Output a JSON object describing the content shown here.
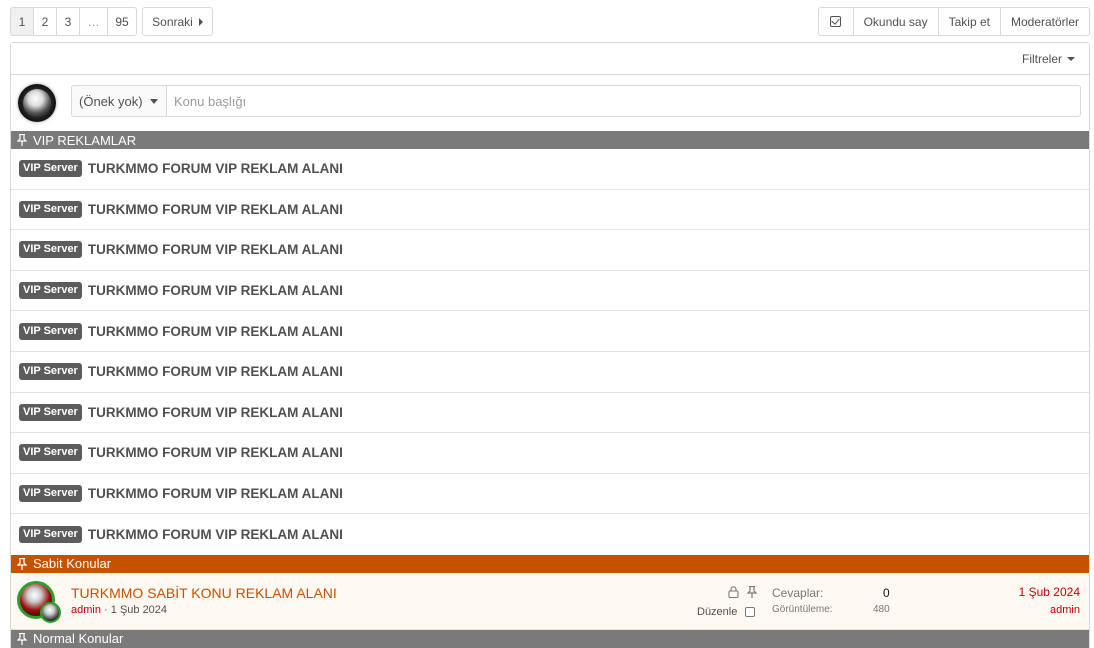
{
  "pagination": {
    "pages": [
      "1",
      "2",
      "3",
      "…",
      "95"
    ],
    "next_label": "Sonraki"
  },
  "actions": {
    "mark_read": "Okundu say",
    "follow": "Takip et",
    "moderators": "Moderatörler"
  },
  "filters_label": "Filtreler",
  "quick_thread": {
    "prefix_value": "(Önek yok)",
    "title_placeholder": "Konu başlığı"
  },
  "sections": {
    "vip": "VIP REKLAMLAR",
    "sticky": "Sabit Konular",
    "normal": "Normal Konular"
  },
  "vip_threads": [
    {
      "prefix": "VIP Server",
      "title": "TURKMMO FORUM VIP REKLAM ALANI"
    },
    {
      "prefix": "VIP Server",
      "title": "TURKMMO FORUM VIP REKLAM ALANI"
    },
    {
      "prefix": "VIP Server",
      "title": "TURKMMO FORUM VIP REKLAM ALANI"
    },
    {
      "prefix": "VIP Server",
      "title": "TURKMMO FORUM VIP REKLAM ALANI"
    },
    {
      "prefix": "VIP Server",
      "title": "TURKMMO FORUM VIP REKLAM ALANI"
    },
    {
      "prefix": "VIP Server",
      "title": "TURKMMO FORUM VIP REKLAM ALANI"
    },
    {
      "prefix": "VIP Server",
      "title": "TURKMMO FORUM VIP REKLAM ALANI"
    },
    {
      "prefix": "VIP Server",
      "title": "TURKMMO FORUM VIP REKLAM ALANI"
    },
    {
      "prefix": "VIP Server",
      "title": "TURKMMO FORUM VIP REKLAM ALANI"
    },
    {
      "prefix": "VIP Server",
      "title": "TURKMMO FORUM VIP REKLAM ALANI"
    }
  ],
  "sticky_thread": {
    "title": "TURKMMO SABİT KONU REKLAM ALANI",
    "author": "admin",
    "separator": "·",
    "date": "1 Şub 2024",
    "edit_label": "Düzenle",
    "replies_label": "Cevaplar:",
    "replies_value": "0",
    "views_label": "Görüntüleme:",
    "views_value": "480",
    "last_date": "1 Şub 2024",
    "last_user": "admin"
  },
  "colors": {
    "vip_header": "#7a7a7a",
    "sticky_header": "#c65100",
    "sticky_row_bg": "#fef8f2",
    "author_red": "#c00000"
  }
}
